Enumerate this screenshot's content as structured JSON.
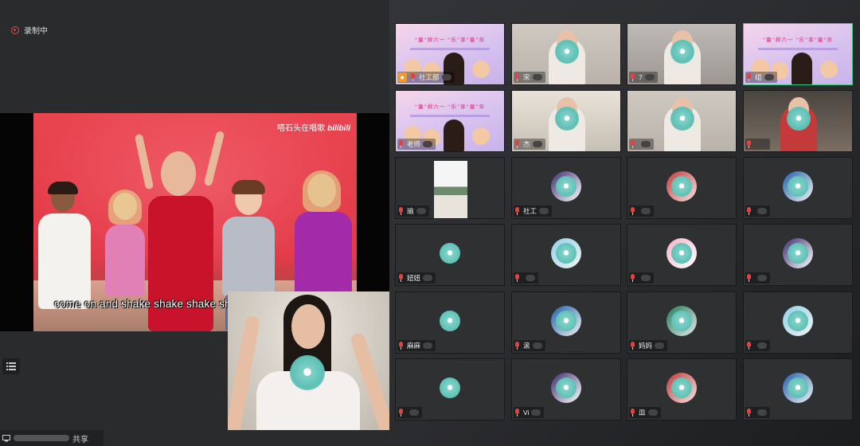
{
  "recording": {
    "label": "录制中",
    "indicator_color": "#e23b3b"
  },
  "video": {
    "watermark_text": "嗒石头在唱歌",
    "watermark_brand": "bilibili",
    "subtitle": "come on and shake shake shake shake shake shake"
  },
  "share": {
    "label": "共享"
  },
  "poster": {
    "title": "“童”样六一 “乐”享“童”年"
  },
  "tiles": [
    {
      "name": "社工部",
      "kind": "poster",
      "host": true,
      "active": false
    },
    {
      "name": "宋",
      "kind": "room",
      "host": false,
      "active": false
    },
    {
      "name": "7",
      "kind": "room2",
      "host": false,
      "active": false
    },
    {
      "name": "组",
      "kind": "poster",
      "host": false,
      "active": true
    },
    {
      "name": "老师",
      "kind": "poster",
      "host": false,
      "active": false
    },
    {
      "name": "杰",
      "kind": "room3",
      "host": false,
      "active": false
    },
    {
      "name": "",
      "kind": "room",
      "host": false,
      "active": false
    },
    {
      "name": "",
      "kind": "room4",
      "host": false,
      "active": false
    },
    {
      "name": "瑜",
      "kind": "photo",
      "host": false,
      "active": false
    },
    {
      "name": "社工",
      "kind": "avatar",
      "host": false,
      "active": false
    },
    {
      "name": "",
      "kind": "avatar",
      "host": false,
      "active": false
    },
    {
      "name": "",
      "kind": "avatar",
      "host": false,
      "active": false
    },
    {
      "name": "妞妞",
      "kind": "blank",
      "host": false,
      "active": false
    },
    {
      "name": "",
      "kind": "avatar",
      "host": false,
      "active": false
    },
    {
      "name": "",
      "kind": "avatar",
      "host": false,
      "active": false
    },
    {
      "name": "",
      "kind": "avatar",
      "host": false,
      "active": false
    },
    {
      "name": "麻麻",
      "kind": "blank",
      "host": false,
      "active": false
    },
    {
      "name": "滚",
      "kind": "avatar",
      "host": false,
      "active": false
    },
    {
      "name": "妈妈",
      "kind": "avatar",
      "host": false,
      "active": false
    },
    {
      "name": "",
      "kind": "avatar",
      "host": false,
      "active": false
    },
    {
      "name": "",
      "kind": "blank",
      "host": false,
      "active": false
    },
    {
      "name": "Vi",
      "kind": "avatar",
      "host": false,
      "active": false
    },
    {
      "name": "皿",
      "kind": "avatar",
      "host": false,
      "active": false
    },
    {
      "name": "",
      "kind": "avatar",
      "host": false,
      "active": false
    }
  ]
}
